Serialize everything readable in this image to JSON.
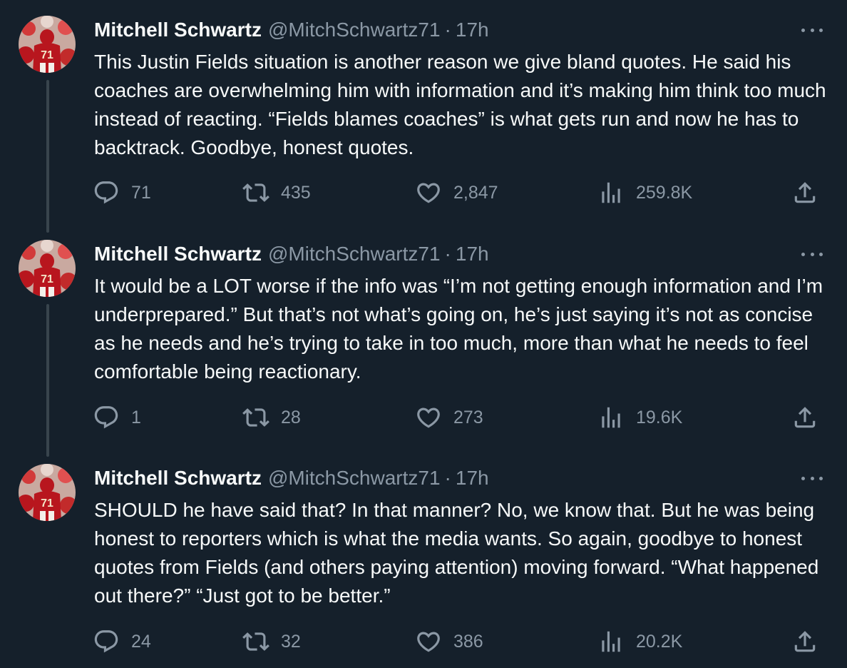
{
  "tweets": [
    {
      "author_name": "Mitchell Schwartz",
      "handle": "@MitchSchwartz71",
      "separator": "·",
      "time": "17h",
      "text": "This Justin Fields situation is another reason we give bland quotes. He said his coaches are overwhelming him with information and it’s making him think too much instead of reacting. “Fields blames coaches” is what gets run and now he has to backtrack. Goodbye, honest quotes.",
      "replies": "71",
      "retweets": "435",
      "likes": "2,847",
      "views": "259.8K"
    },
    {
      "author_name": "Mitchell Schwartz",
      "handle": "@MitchSchwartz71",
      "separator": "·",
      "time": "17h",
      "text": "It would be a LOT worse if the info was “I’m not getting enough information and I’m underprepared.” But that’s not what’s going on, he’s just saying it’s not as concise as he needs and he’s trying to take in too much, more than what he needs to feel comfortable being reactionary.",
      "replies": "1",
      "retweets": "28",
      "likes": "273",
      "views": "19.6K"
    },
    {
      "author_name": "Mitchell Schwartz",
      "handle": "@MitchSchwartz71",
      "separator": "·",
      "time": "17h",
      "text": "SHOULD he have said that? In that manner? No, we know that. But he was being honest to reporters which is what the media wants. So again, goodbye to honest quotes from Fields (and others paying attention) moving forward. “What happened out there?” “Just got to be better.”",
      "replies": "24",
      "retweets": "32",
      "likes": "386",
      "views": "20.2K"
    }
  ],
  "icons": {
    "reply": "reply-icon",
    "retweet": "retweet-icon",
    "like": "heart-icon",
    "views": "views-chart-icon",
    "share": "share-icon",
    "more": "more-options-icon"
  },
  "colors": {
    "background": "#15202b",
    "text_primary": "#f7f9f9",
    "text_secondary": "#8b98a5",
    "thread_line": "#38444d",
    "avatar_red": "#b8161e"
  }
}
